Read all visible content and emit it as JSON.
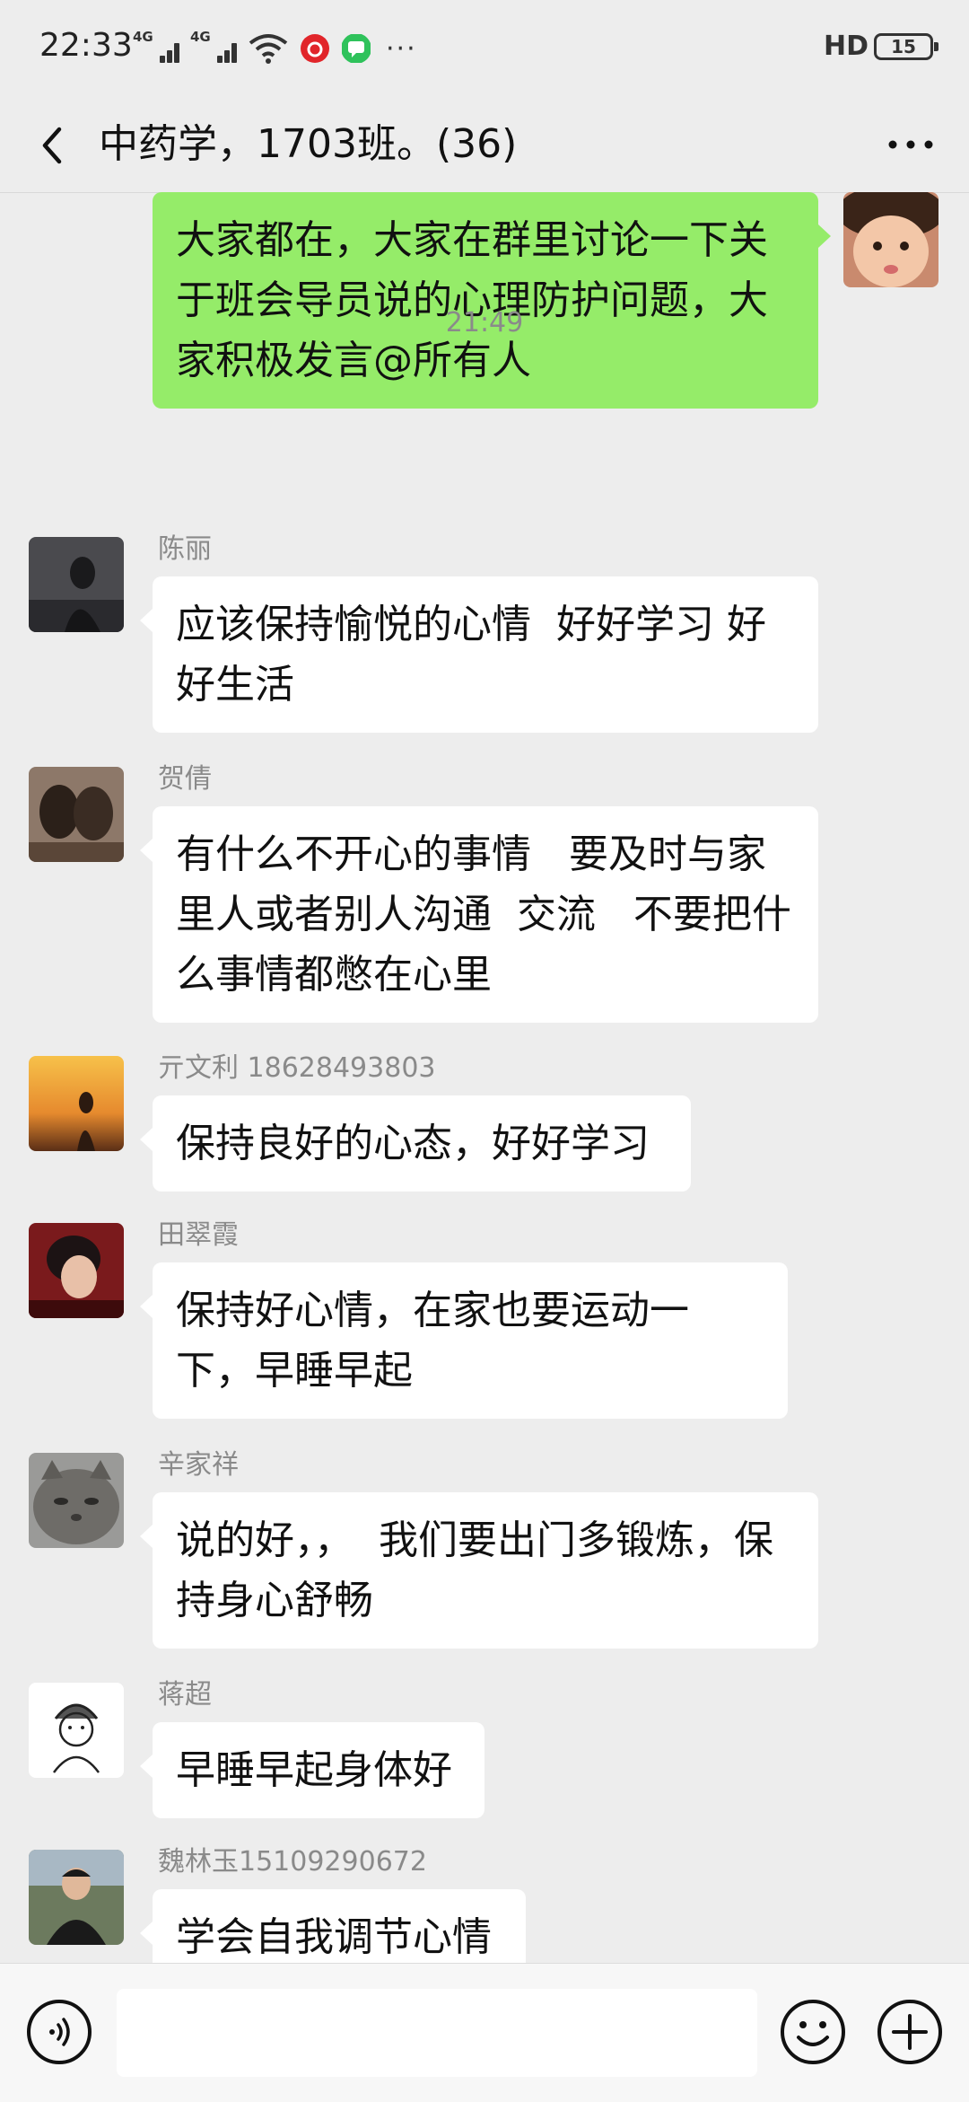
{
  "status_bar": {
    "time": "22:33",
    "signal1": "4G",
    "signal2": "4G",
    "more": "···",
    "hd": "HD",
    "battery": "15"
  },
  "header": {
    "title": "中药学，1703班。(36)"
  },
  "chat": {
    "outgoing_message": "大家都在，大家在群里讨论一下关于班会导员说的心理防护问题，大家积极发言@所有人",
    "timestamp": "21:49",
    "messages": [
      {
        "name": "陈丽",
        "text": "应该保持愉悦的心情  好好学习 好好生活"
      },
      {
        "name": "贺倩",
        "text": "有什么不开心的事情   要及时与家里人或者别人沟通  交流   不要把什么事情都憋在心里"
      },
      {
        "name": "亓文利  18628493803",
        "text": "保持良好的心态，好好学习"
      },
      {
        "name": "田翠霞",
        "text": "保持好心情，在家也要运动一下，早睡早起"
      },
      {
        "name": "辛家祥",
        "text": "说的好，，  我们要出门多锻炼，保持身心舒畅"
      },
      {
        "name": "蒋超",
        "text": "早睡早起身体好"
      },
      {
        "name": "魏林玉15109290672",
        "text": "学会自我调节心情"
      }
    ]
  },
  "input_bar": {
    "value": ""
  },
  "colors": {
    "background": "#ededed",
    "outgoing_bubble": "#95ec69",
    "incoming_bubble": "#ffffff"
  }
}
